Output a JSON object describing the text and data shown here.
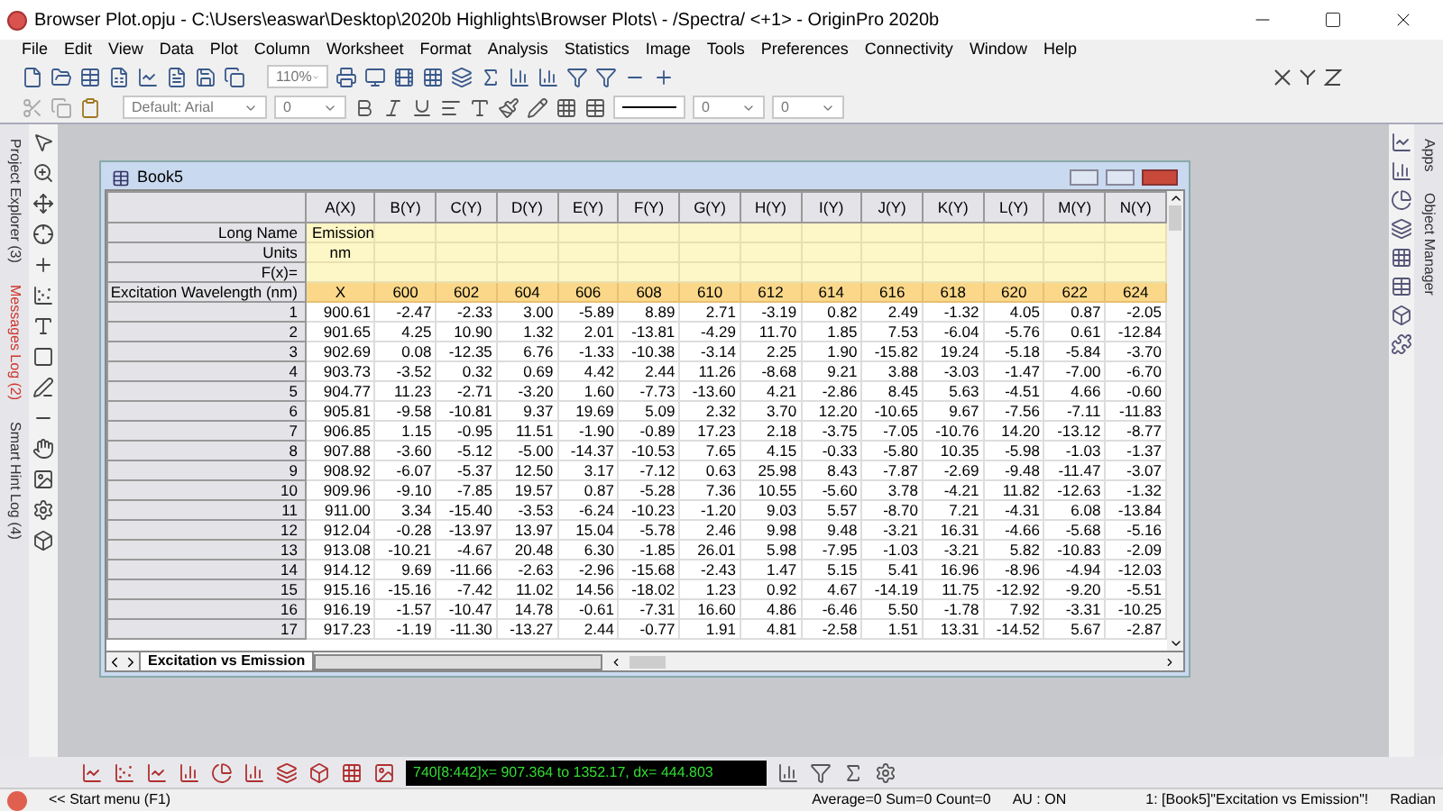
{
  "window": {
    "title": "Browser Plot.opju - C:\\Users\\easwar\\Desktop\\2020b Highlights\\Browser Plots\\ - /Spectra/ <+1> - OriginPro 2020b"
  },
  "menu": [
    "File",
    "Edit",
    "View",
    "Data",
    "Plot",
    "Column",
    "Worksheet",
    "Format",
    "Analysis",
    "Statistics",
    "Image",
    "Tools",
    "Preferences",
    "Connectivity",
    "Window",
    "Help"
  ],
  "toolbar": {
    "zoom": "110%",
    "font": "Default: Arial",
    "font_size": "0",
    "line_size": "0",
    "pattern_size": "0"
  },
  "side_tabs": [
    {
      "label": "Project Explorer (3)",
      "selected": false
    },
    {
      "label": "Messages Log (2)",
      "selected": true
    },
    {
      "label": "Smart Hint Log (4)",
      "selected": false
    }
  ],
  "right_tabs": [
    "Apps",
    "Object Manager"
  ],
  "workbook": {
    "title": "Book5",
    "columns": [
      "A(X)",
      "B(Y)",
      "C(Y)",
      "D(Y)",
      "E(Y)",
      "F(Y)",
      "G(Y)",
      "H(Y)",
      "I(Y)",
      "J(Y)",
      "K(Y)",
      "L(Y)",
      "M(Y)",
      "N(Y)"
    ],
    "label_rows": [
      {
        "label": "Long Name",
        "first": "Emission"
      },
      {
        "label": "Units",
        "first": "nm"
      },
      {
        "label": "F(x)="
      }
    ],
    "param_row": {
      "label": "Excitation Wavelength (nm)",
      "values": [
        "X",
        "600",
        "602",
        "604",
        "606",
        "608",
        "610",
        "612",
        "614",
        "616",
        "618",
        "620",
        "622",
        "624"
      ]
    },
    "rows": [
      {
        "index": "1",
        "cells": [
          "900.61",
          "-2.47",
          "-2.33",
          "3.00",
          "-5.89",
          "8.89",
          "2.71",
          "-3.19",
          "0.82",
          "2.49",
          "-1.32",
          "4.05",
          "0.87",
          "-2.05"
        ]
      },
      {
        "index": "2",
        "cells": [
          "901.65",
          "4.25",
          "10.90",
          "1.32",
          "2.01",
          "-13.81",
          "-4.29",
          "11.70",
          "1.85",
          "7.53",
          "-6.04",
          "-5.76",
          "0.61",
          "-12.84"
        ]
      },
      {
        "index": "3",
        "cells": [
          "902.69",
          "0.08",
          "-12.35",
          "6.76",
          "-1.33",
          "-10.38",
          "-3.14",
          "2.25",
          "1.90",
          "-15.82",
          "19.24",
          "-5.18",
          "-5.84",
          "-3.70"
        ]
      },
      {
        "index": "4",
        "cells": [
          "903.73",
          "-3.52",
          "0.32",
          "0.69",
          "4.42",
          "2.44",
          "11.26",
          "-8.68",
          "9.21",
          "3.88",
          "-3.03",
          "-1.47",
          "-7.00",
          "-6.70"
        ]
      },
      {
        "index": "5",
        "cells": [
          "904.77",
          "11.23",
          "-2.71",
          "-3.20",
          "1.60",
          "-7.73",
          "-13.60",
          "4.21",
          "-2.86",
          "8.45",
          "5.63",
          "-4.51",
          "4.66",
          "-0.60"
        ]
      },
      {
        "index": "6",
        "cells": [
          "905.81",
          "-9.58",
          "-10.81",
          "9.37",
          "19.69",
          "5.09",
          "2.32",
          "3.70",
          "12.20",
          "-10.65",
          "9.67",
          "-7.56",
          "-7.11",
          "-11.83"
        ]
      },
      {
        "index": "7",
        "cells": [
          "906.85",
          "1.15",
          "-0.95",
          "11.51",
          "-1.90",
          "-0.89",
          "17.23",
          "2.18",
          "-3.75",
          "-7.05",
          "-10.76",
          "14.20",
          "-13.12",
          "-8.77"
        ]
      },
      {
        "index": "8",
        "cells": [
          "907.88",
          "-3.60",
          "-5.12",
          "-5.00",
          "-14.37",
          "-10.53",
          "7.65",
          "4.15",
          "-0.33",
          "-5.80",
          "10.35",
          "-5.98",
          "-1.03",
          "-1.37"
        ]
      },
      {
        "index": "9",
        "cells": [
          "908.92",
          "-6.07",
          "-5.37",
          "12.50",
          "3.17",
          "-7.12",
          "0.63",
          "25.98",
          "8.43",
          "-7.87",
          "-2.69",
          "-9.48",
          "-11.47",
          "-3.07"
        ]
      },
      {
        "index": "10",
        "cells": [
          "909.96",
          "-9.10",
          "-7.85",
          "19.57",
          "0.87",
          "-5.28",
          "7.36",
          "10.55",
          "-5.60",
          "3.78",
          "-4.21",
          "11.82",
          "-12.63",
          "-1.32"
        ]
      },
      {
        "index": "11",
        "cells": [
          "911.00",
          "3.34",
          "-15.40",
          "-3.53",
          "-6.24",
          "-10.23",
          "-1.20",
          "9.03",
          "5.57",
          "-8.70",
          "7.21",
          "-4.31",
          "6.08",
          "-13.84"
        ]
      },
      {
        "index": "12",
        "cells": [
          "912.04",
          "-0.28",
          "-13.97",
          "13.97",
          "15.04",
          "-5.78",
          "2.46",
          "9.98",
          "9.48",
          "-3.21",
          "16.31",
          "-4.66",
          "-5.68",
          "-5.16"
        ]
      },
      {
        "index": "13",
        "cells": [
          "913.08",
          "-10.21",
          "-4.67",
          "20.48",
          "6.30",
          "-1.85",
          "26.01",
          "5.98",
          "-7.95",
          "-1.03",
          "-3.21",
          "5.82",
          "-10.83",
          "-2.09"
        ]
      },
      {
        "index": "14",
        "cells": [
          "914.12",
          "9.69",
          "-11.66",
          "-2.63",
          "-2.96",
          "-15.68",
          "-2.43",
          "1.47",
          "5.15",
          "5.41",
          "16.96",
          "-8.96",
          "-4.94",
          "-12.03"
        ]
      },
      {
        "index": "15",
        "cells": [
          "915.16",
          "-15.16",
          "-7.42",
          "11.02",
          "14.56",
          "-18.02",
          "1.23",
          "0.92",
          "4.67",
          "-14.19",
          "11.75",
          "-12.92",
          "-9.20",
          "-5.51"
        ]
      },
      {
        "index": "16",
        "cells": [
          "916.19",
          "-1.57",
          "-10.47",
          "14.78",
          "-0.61",
          "-7.31",
          "16.60",
          "4.86",
          "-6.46",
          "5.50",
          "-1.78",
          "7.92",
          "-3.31",
          "-10.25"
        ]
      },
      {
        "index": "17",
        "cells": [
          "917.23",
          "-1.19",
          "-11.30",
          "-13.27",
          "2.44",
          "-0.77",
          "1.91",
          "4.81",
          "-2.58",
          "1.51",
          "13.31",
          "-14.52",
          "5.67",
          "-2.87"
        ]
      }
    ],
    "sheet_tab": "Excitation vs Emission"
  },
  "readout": "740[8:442]x= 907.364 to 1352.17, dx= 444.803",
  "status": {
    "start": "<< Start menu (F1)",
    "stats": "Average=0 Sum=0 Count=0",
    "au": "AU : ON",
    "sheet": "1: [Book5]\"Excitation vs Emission\"!",
    "angle": "Radian"
  }
}
